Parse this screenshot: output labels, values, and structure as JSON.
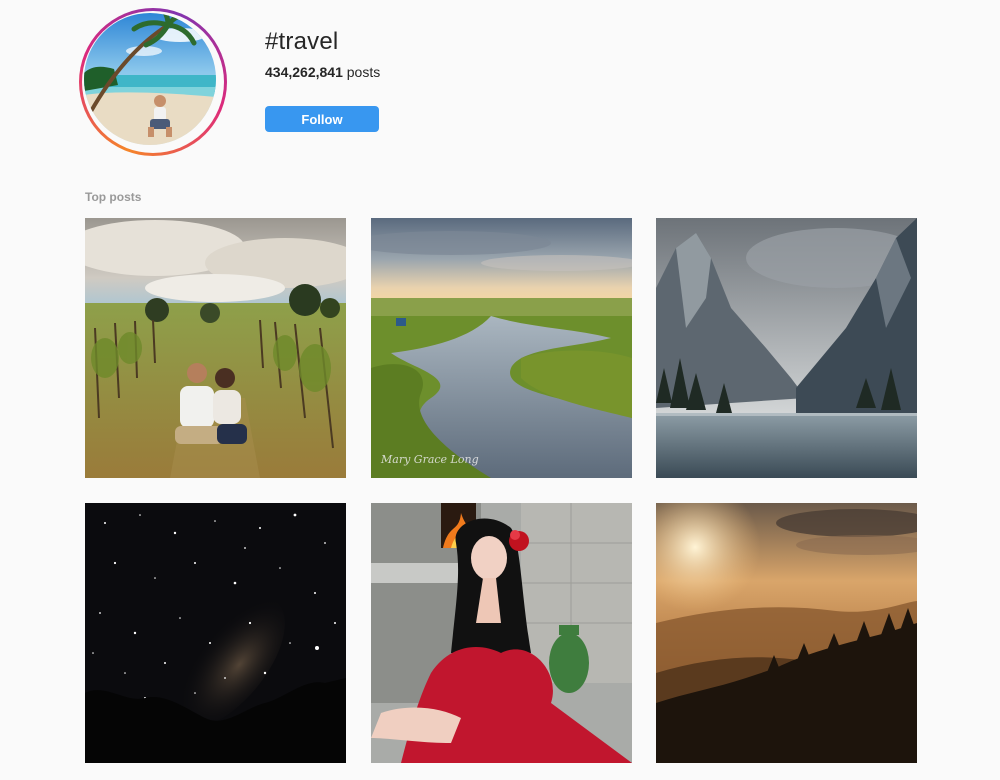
{
  "hashtag": {
    "title": "#travel",
    "post_count": "434,262,841",
    "post_suffix": " posts",
    "follow_label": "Follow",
    "accent_color": "#3897f0"
  },
  "top_posts": {
    "label": "Top posts",
    "posts": [
      {
        "subject": "couple-in-vineyard"
      },
      {
        "subject": "marsh-river-sunset",
        "watermark": "Mary Grace Long"
      },
      {
        "subject": "mountain-lake"
      },
      {
        "subject": "milky-way-night-sky"
      },
      {
        "subject": "woman-red-dress-flower"
      },
      {
        "subject": "misty-mountain-sunset"
      }
    ]
  }
}
